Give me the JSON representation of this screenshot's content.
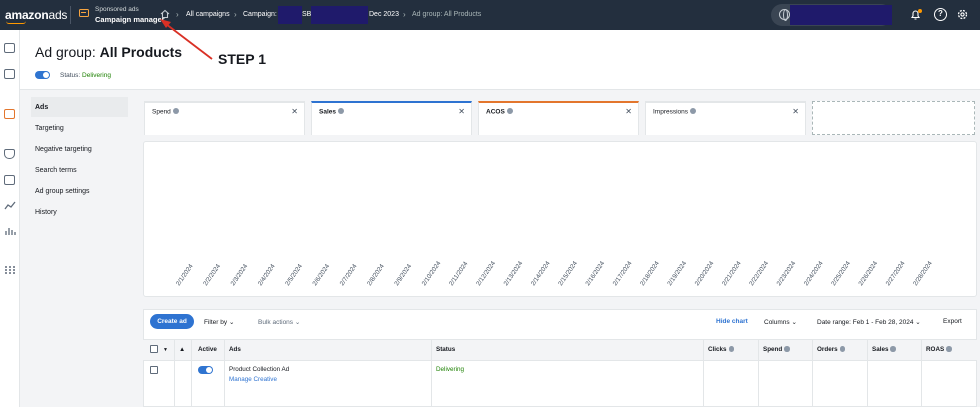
{
  "topbar": {
    "logo_main": "amazon",
    "logo_suffix": "ads",
    "product_small": "Sponsored ads",
    "product_big": "Campaign manager",
    "breadcrumb": {
      "all_campaigns": "All campaigns",
      "campaign_prefix": "Campaign:",
      "campaign_fragment_1": "SB",
      "campaign_fragment_2": "Dec 2023",
      "current": "Ad group: All Products"
    }
  },
  "page": {
    "title_prefix": "Ad group:",
    "title_name": "All Products",
    "status_label": "Status:",
    "status_value": "Delivering"
  },
  "annotation": {
    "step_label": "STEP 1",
    "arrow_color": "#d93025"
  },
  "side_nav": [
    {
      "label": "Ads",
      "active": true
    },
    {
      "label": "Targeting",
      "active": false
    },
    {
      "label": "Negative targeting",
      "active": false
    },
    {
      "label": "Search terms",
      "active": false
    },
    {
      "label": "Ad group settings",
      "active": false
    },
    {
      "label": "History",
      "active": false
    }
  ],
  "metric_cards": [
    {
      "label": "Spend",
      "bold": false,
      "color": "#e3e6e8"
    },
    {
      "label": "Sales",
      "bold": true,
      "color": "#2e73d1"
    },
    {
      "label": "ACOS",
      "bold": true,
      "color": "#e3762d"
    },
    {
      "label": "Impressions",
      "bold": false,
      "color": "#e3e6e8"
    }
  ],
  "chart_data": {
    "type": "line",
    "x": [
      "2/1/2024",
      "2/2/2024",
      "2/3/2024",
      "2/4/2024",
      "2/5/2024",
      "2/6/2024",
      "2/7/2024",
      "2/8/2024",
      "2/9/2024",
      "2/10/2024",
      "2/11/2024",
      "2/12/2024",
      "2/13/2024",
      "2/14/2024",
      "2/15/2024",
      "2/16/2024",
      "2/17/2024",
      "2/18/2024",
      "2/19/2024",
      "2/20/2024",
      "2/21/2024",
      "2/22/2024",
      "2/23/2024",
      "2/24/2024",
      "2/25/2024",
      "2/26/2024",
      "2/27/2024",
      "2/28/2024"
    ],
    "series": [],
    "title": "",
    "xlabel": "",
    "ylabel": ""
  },
  "toolbar": {
    "create": "Create ad",
    "filter": "Filter by",
    "bulk": "Bulk actions",
    "hide_chart": "Hide chart",
    "columns": "Columns",
    "date_range": "Date range: Feb 1 - Feb 28, 2024",
    "export": "Export"
  },
  "table": {
    "headers": {
      "warning": "▲",
      "active": "Active",
      "ads": "Ads",
      "status": "Status",
      "clicks": "Clicks",
      "spend": "Spend",
      "orders": "Orders",
      "sales": "Sales",
      "roas": "ROAS"
    },
    "rows": [
      {
        "ad_name": "Product Collection Ad",
        "ad_link": "Manage Creative",
        "status": "Delivering"
      }
    ]
  }
}
